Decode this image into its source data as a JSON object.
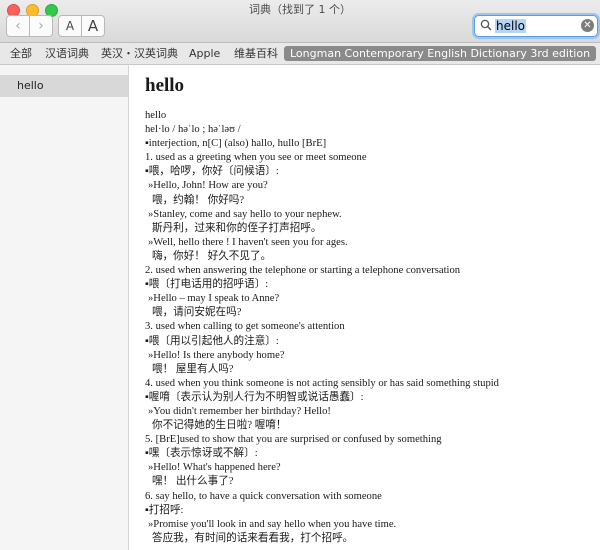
{
  "window": {
    "title": "词典（找到了 1 个）"
  },
  "toolbar": {
    "back_glyph": "‹",
    "forward_glyph": "›",
    "font_small": "A",
    "font_large": "A",
    "search_value": "hello",
    "clear_glyph": "✕"
  },
  "tabs": [
    {
      "label": "全部"
    },
    {
      "label": "汉语词典"
    },
    {
      "label": "英汉・汉英词典"
    },
    {
      "label": "Apple"
    },
    {
      "label": "维基百科"
    },
    {
      "label": "Longman Contemporary English Dictionary 3rd edition",
      "active": true
    }
  ],
  "sidebar": {
    "items": [
      {
        "label": "hello"
      }
    ]
  },
  "entry": {
    "headword": "hello",
    "lines": [
      {
        "text": "hello",
        "kind": "plain"
      },
      {
        "text": "hel·lo / həˈlo ; həˈləʊ /",
        "kind": "plain"
      },
      {
        "text": "▪interjection, n[C] (also)  hallo, hullo [BrE]",
        "kind": "plain"
      },
      {
        "text": "1. used as a greeting when you see or meet someone",
        "kind": "plain"
      },
      {
        "text": "▪喂，哈啰，你好〔问候语〕:",
        "kind": "plain"
      },
      {
        "text": "»Hello, John! How are you?",
        "kind": "ex"
      },
      {
        "text": "喂，约翰！ 你好吗?",
        "kind": "cn"
      },
      {
        "text": "»Stanley, come and say hello to your nephew.",
        "kind": "ex"
      },
      {
        "text": "斯丹利，过来和你的侄子打声招呼。",
        "kind": "cn"
      },
      {
        "text": "»Well, hello there ! I haven't seen you for ages.",
        "kind": "ex"
      },
      {
        "text": "嗨，你好！ 好久不见了。",
        "kind": "cn"
      },
      {
        "text": "2. used when answering the telephone or starting a telephone conversation",
        "kind": "plain"
      },
      {
        "text": "▪喂〔打电话用的招呼语〕:",
        "kind": "plain"
      },
      {
        "text": "»Hello – may I speak to Anne?",
        "kind": "ex"
      },
      {
        "text": "喂，请问安妮在吗?",
        "kind": "cn"
      },
      {
        "text": "3. used when calling to get someone's attention",
        "kind": "plain"
      },
      {
        "text": "▪喂〔用以引起他人的注意〕:",
        "kind": "plain"
      },
      {
        "text": "»Hello! Is there anybody home?",
        "kind": "ex"
      },
      {
        "text": "喂！ 屋里有人吗?",
        "kind": "cn"
      },
      {
        "text": "4. used when you think someone is not acting sensibly or has said something stupid",
        "kind": "plain"
      },
      {
        "text": "▪喔唷〔表示认为别人行为不明智或说话愚蠢〕:",
        "kind": "plain"
      },
      {
        "text": "»You didn't remember her birthday? Hello!",
        "kind": "ex"
      },
      {
        "text": "你不记得她的生日啦? 喔唷！",
        "kind": "cn"
      },
      {
        "text": "5. [BrE]used to show that you are surprised or confused by something",
        "kind": "plain"
      },
      {
        "text": "▪嘿〔表示惊讶或不解〕:",
        "kind": "plain"
      },
      {
        "text": "»Hello! What's happened here?",
        "kind": "ex"
      },
      {
        "text": "嘿！ 出什么事了?",
        "kind": "cn"
      },
      {
        "text": "6. say hello,  to have a quick conversation with someone",
        "kind": "plain"
      },
      {
        "text": "▪打招呼:",
        "kind": "plain"
      },
      {
        "text": "»Promise you'll look in and say hello when you have time.",
        "kind": "ex"
      },
      {
        "text": "答应我，有时间的话来看看我，打个招呼。",
        "kind": "cn"
      }
    ]
  },
  "colors": {
    "close": "#fc5f57",
    "minimize": "#fdbc2e",
    "zoom": "#34c84a",
    "active_tab": "#8a8a8a",
    "search_focus": "#5c9de6"
  }
}
